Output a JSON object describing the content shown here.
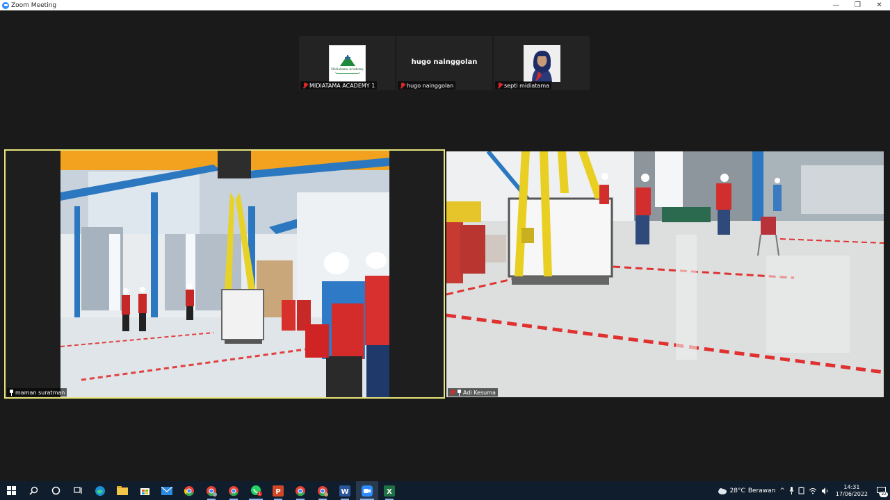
{
  "window": {
    "title": "Zoom Meeting",
    "controls": {
      "minimize": "—",
      "restore": "❐",
      "close": "✕"
    }
  },
  "thumbnails": [
    {
      "name": "MIDIATAMA ACADEMY 1",
      "muted": true,
      "avatar": "logo",
      "logo_text": "Midiatama Academy"
    },
    {
      "name": "hugo nainggolan",
      "muted": true,
      "avatar": "name",
      "display_name": "hugo nainggolan"
    },
    {
      "name": "septi midiatama",
      "muted": true,
      "avatar": "photo"
    }
  ],
  "videos": [
    {
      "name": "maman suratman",
      "pinned": true,
      "muted": false,
      "active_speaker": true,
      "border_color": "#e9e57a"
    },
    {
      "name": "Adi Kesuma",
      "pinned": true,
      "muted": true,
      "active_speaker": false
    }
  ],
  "taskbar": {
    "apps": [
      "windows-start",
      "search",
      "cortana",
      "task-view",
      "edge",
      "file-explorer",
      "store",
      "mail",
      "chrome",
      "chrome-profile-2",
      "chrome-profile-3",
      "whatsapp",
      "powerpoint",
      "chrome-profile-4",
      "chrome-profile-5",
      "word",
      "zoom",
      "excel"
    ],
    "whatsapp_badge": "1",
    "weather": {
      "temp": "28°C",
      "condition": "Berawan"
    },
    "time": "14:31",
    "date": "17/06/2022",
    "notifications": "22"
  },
  "colors": {
    "active_speaker_border": "#e9e57a",
    "taskbar_bg": "#101d2c",
    "mute_red": "#e02828",
    "zoom_blue": "#2d8cff"
  }
}
